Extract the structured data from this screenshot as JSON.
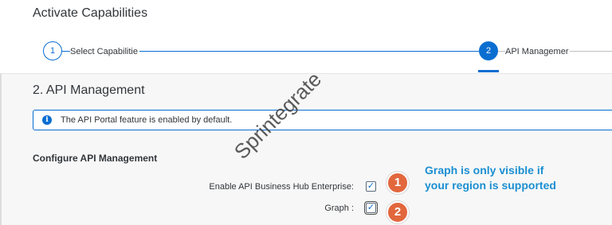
{
  "header": {
    "title": "Activate Capabilities"
  },
  "wizard": {
    "steps": [
      {
        "number": "1",
        "label": "Select Capabilitie"
      },
      {
        "number": "2",
        "label": "API Managemer"
      }
    ]
  },
  "main": {
    "section_title": "2. API Management",
    "info_message": "The API Portal feature is enabled by default.",
    "config_heading": "Configure API Management",
    "options": [
      {
        "label": "Enable API Business Hub Enterprise:",
        "checked": true
      },
      {
        "label": "Graph :",
        "checked": true
      }
    ]
  },
  "annotations": {
    "badges": [
      "1",
      "2"
    ],
    "callout_line1": "Graph is only visible if",
    "callout_line2": "your region is supported",
    "watermark": "Sprintegrate"
  },
  "colors": {
    "accent": "#0a6ed1",
    "badge": "#e2673d",
    "callout": "#1b8fd2"
  }
}
